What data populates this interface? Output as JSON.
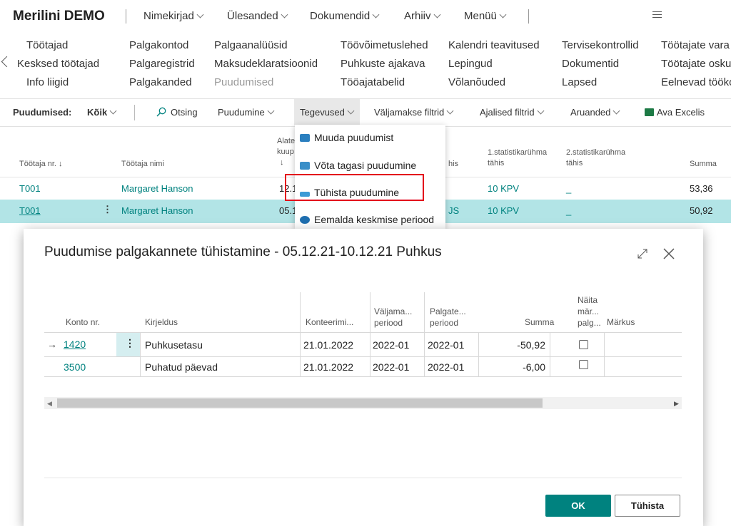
{
  "header": {
    "company": "Merilini DEMO",
    "nav": [
      "Nimekirjad",
      "Ülesanded",
      "Dokumendid",
      "Arhiiv",
      "Menüü"
    ]
  },
  "links": {
    "col1": [
      "Töötajad",
      "Kesksed töötajad",
      "Info liigid"
    ],
    "col2": [
      "Palgakontod",
      "Palgaregistrid",
      "Palgakanded"
    ],
    "col3": [
      "Palgaanalüüsid",
      "Maksudeklaratsioonid",
      "Puudumised"
    ],
    "col4": [
      "Töövõimetuslehed",
      "Puhkuste ajakava",
      "Tööajatabelid"
    ],
    "col5": [
      "Kalendri teavitused",
      "Lepingud",
      "Võlanõuded"
    ],
    "col6": [
      "Tervisekontrollid",
      "Dokumentid",
      "Lapsed"
    ],
    "col7": [
      "Töötajate vara",
      "Töötajate osku",
      "Eelnevad tööko"
    ]
  },
  "actions": {
    "page_label": "Puudumised:",
    "filter": "Kõik",
    "search": "Otsing",
    "puudumine": "Puudumine",
    "tegevused": "Tegevused",
    "valjamakse": "Väljamakse filtrid",
    "ajalised": "Ajalised filtrid",
    "aruanded": "Aruanded",
    "excel": "Ava Excelis"
  },
  "list": {
    "headers": {
      "emp_no": "Töötaja nr. ↓",
      "emp_name": "Töötaja nimi",
      "alate_1": "Alate",
      "alate_2": "kuup",
      "alate_3": "↓",
      "tahis": "his",
      "stat1_1": "1.statistikarühma",
      "stat1_2": "tähis",
      "stat2_1": "2.statistikarühma",
      "stat2_2": "tähis",
      "summa": "Summa"
    },
    "rows": [
      {
        "emp_no": "T001",
        "name": "Margaret Hanson",
        "date": "12.1",
        "code": "",
        "stat1": "10 KPV",
        "stat2": "_",
        "sum": "53,36"
      },
      {
        "emp_no": "T001",
        "name": "Margaret Hanson",
        "date": "05.1",
        "code": "JS",
        "stat1": "10 KPV",
        "stat2": "_",
        "sum": "50,92"
      }
    ]
  },
  "menu": {
    "items": [
      "Muuda puudumist",
      "Võta tagasi puudumine",
      "Tühista puudumine",
      "Eemalda keskmise periood"
    ]
  },
  "dialog": {
    "title": "Puudumise palgakannete tühistamine - 05.12.21-10.12.21 Puhkus",
    "headers": {
      "konto": "Konto nr.",
      "kirjeldus": "Kirjeldus",
      "konteerimi": "Konteerimi...",
      "valjama_1": "Väljama...",
      "valjama_2": "periood",
      "palgate_1": "Palgate...",
      "palgate_2": "periood",
      "summa": "Summa",
      "naita_1": "Näita",
      "naita_2": "mär...",
      "naita_3": "palg...",
      "markus": "Märkus"
    },
    "rows": [
      {
        "konto": "1420",
        "kirjeldus": "Puhkusetasu",
        "date": "21.01.2022",
        "valjama": "2022-01",
        "palgate": "2022-01",
        "summa": "-50,92"
      },
      {
        "konto": "3500",
        "kirjeldus": "Puhatud päevad",
        "date": "21.01.2022",
        "valjama": "2022-01",
        "palgate": "2022-01",
        "summa": "-6,00"
      }
    ],
    "ok": "OK",
    "cancel": "Tühista"
  },
  "colors": {
    "accent": "#00827f",
    "highlight_row": "#b2e4e6",
    "red_box": "#e3001b"
  }
}
